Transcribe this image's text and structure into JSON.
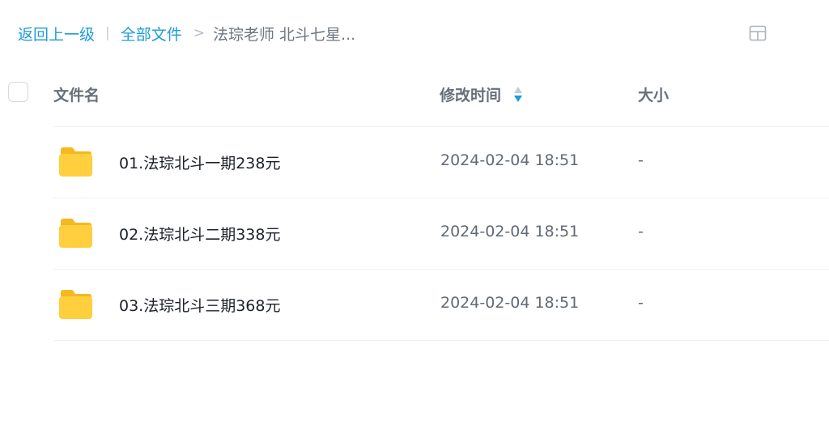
{
  "breadcrumb": {
    "back_label": "返回上一级",
    "separator": "|",
    "root_label": "全部文件",
    "arrow": ">",
    "current_label": "法琮老师 北斗七星..."
  },
  "header": {
    "name_label": "文件名",
    "time_label": "修改时间",
    "size_label": "大小"
  },
  "files": [
    {
      "name": "01.法琮北斗一期238元",
      "modified": "2024-02-04 18:51",
      "size": "-",
      "icon": "folder-icon"
    },
    {
      "name": "02.法琮北斗二期338元",
      "modified": "2024-02-04 18:51",
      "size": "-",
      "icon": "folder-icon"
    },
    {
      "name": "03.法琮北斗三期368元",
      "modified": "2024-02-04 18:51",
      "size": "-",
      "icon": "folder-icon"
    }
  ],
  "colors": {
    "link": "#1f9bd7",
    "sort_active": "#1f9bd7",
    "folder": "#ffcf3d"
  },
  "icons": {
    "view_toggle": "grid-view-icon",
    "sort": "sort-icon"
  }
}
